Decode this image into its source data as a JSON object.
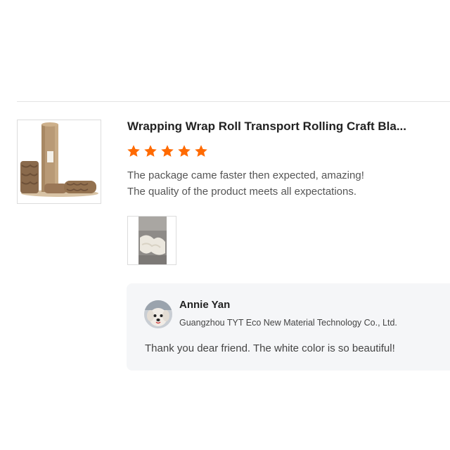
{
  "product": {
    "title": "Wrapping Wrap Roll Transport Rolling Craft Bla...",
    "image_icon": "kraft-paper-roll-image"
  },
  "rating": {
    "value": 5,
    "max": 5,
    "star_color": "#ff6a00"
  },
  "review": {
    "lines": [
      "The package came faster then expected, amazing!",
      "The quality of the product meets all expectations."
    ],
    "photo_icon": "review-photo-thumbnail"
  },
  "seller_reply": {
    "name": "Annie Yan",
    "company": "Guangzhou TYT Eco New Material Technology Co., Ltd.",
    "text": "Thank you dear friend. The white color is so beautiful!",
    "avatar_icon": "dog-avatar"
  }
}
